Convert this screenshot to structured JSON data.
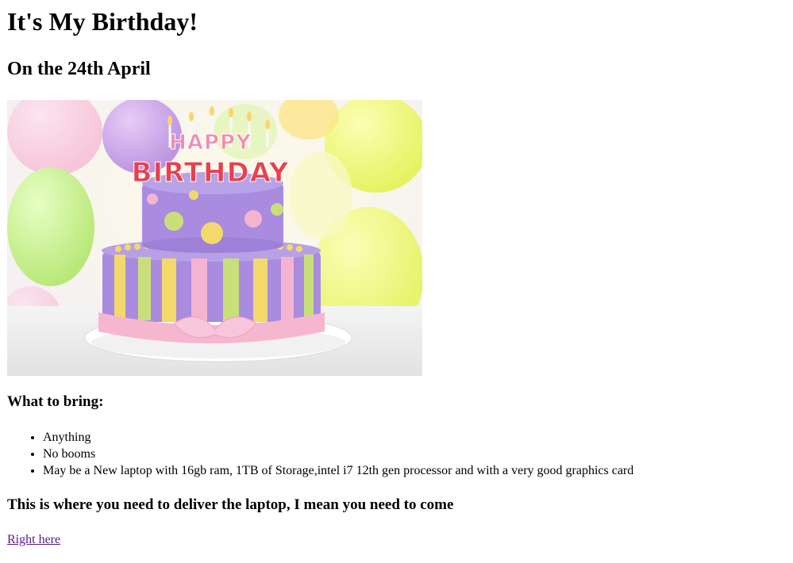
{
  "page": {
    "title": "It's My Birthday!",
    "date_heading": "On the 24th April",
    "image": {
      "alt": "birthday cake",
      "icon": "birthday-cake-image",
      "cake_topper_line1": "HAPPY",
      "cake_topper_line2": "BIRTHDAY"
    },
    "bring_heading": "What to bring:",
    "bring_items": [
      "Anything",
      "No booms",
      "May be a New laptop with 16gb ram, 1TB of Storage,intel i7 12th gen processor and with a very good graphics card"
    ],
    "deliver_heading": "This is where you need to deliver the laptop, I mean you need to come",
    "link_text": "Right here"
  },
  "colors": {
    "link_visited": "#551a8b",
    "text": "#000000",
    "background": "#ffffff"
  }
}
